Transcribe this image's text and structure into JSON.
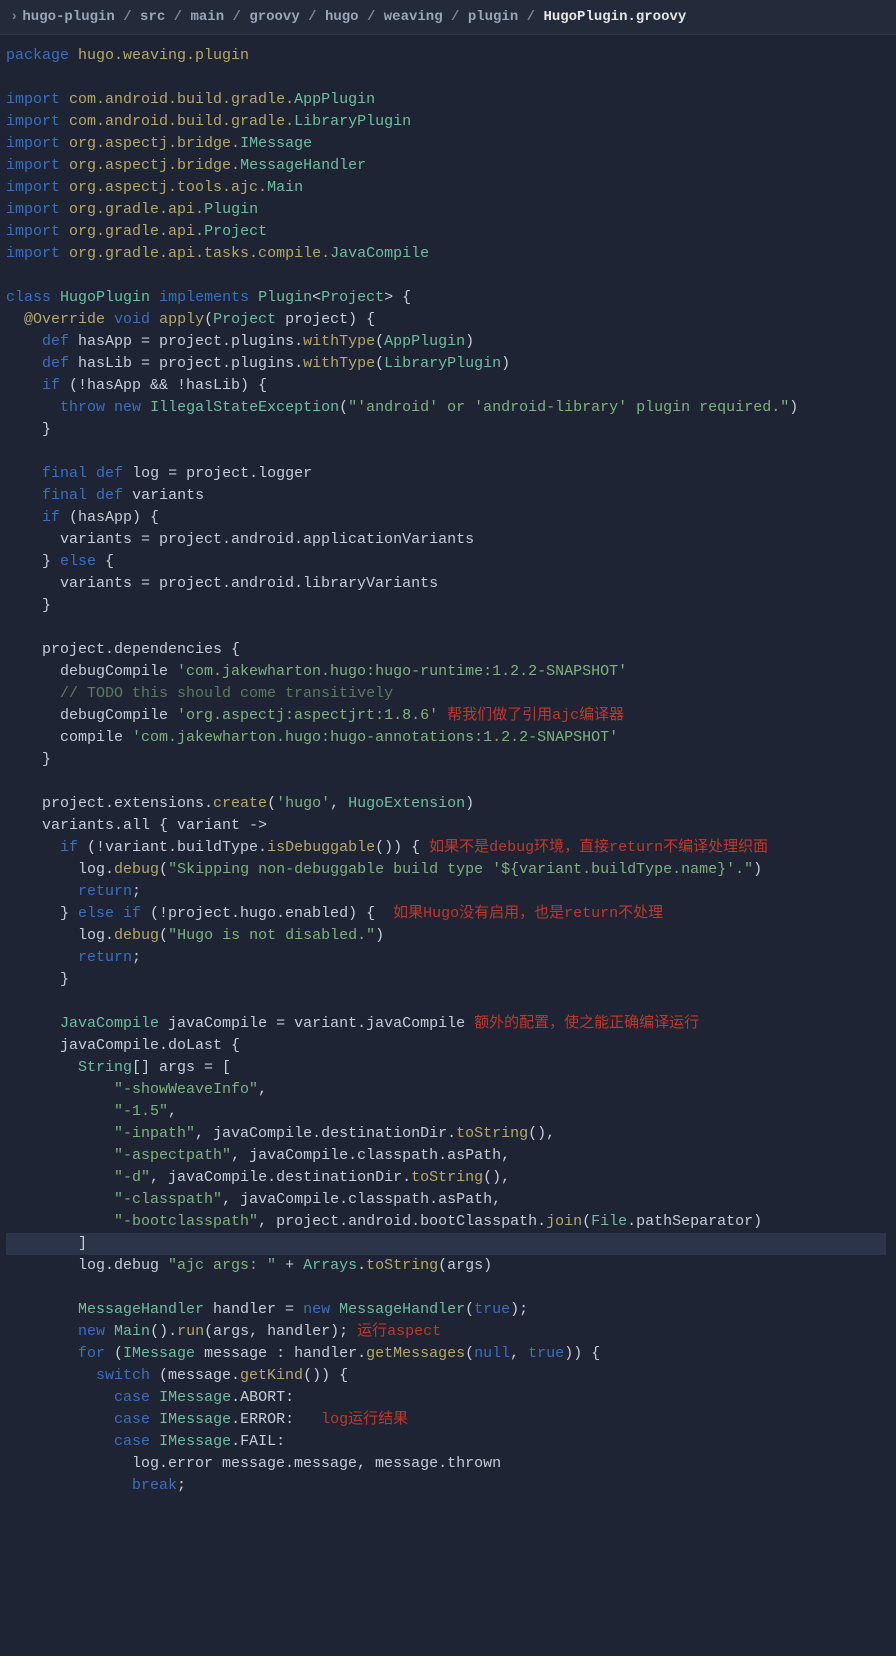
{
  "breadcrumb": {
    "segs": [
      "hugo-plugin",
      "src",
      "main",
      "groovy",
      "hugo",
      "weaving",
      "plugin",
      "HugoPlugin.groovy"
    ],
    "active_index": 7
  },
  "lines": [
    {
      "h": "<span class='kw'>package</span> <span class='pkg'>hugo.weaving.plugin</span>"
    },
    {
      "h": ""
    },
    {
      "h": "<span class='kw'>import</span> <span class='pkg'>com.android.build.gradle.</span><span class='typ'>AppPlugin</span>"
    },
    {
      "h": "<span class='kw'>import</span> <span class='pkg'>com.android.build.gradle.</span><span class='typ'>LibraryPlugin</span>"
    },
    {
      "h": "<span class='kw'>import</span> <span class='pkg'>org.aspectj.bridge.</span><span class='typ'>IMessage</span>"
    },
    {
      "h": "<span class='kw'>import</span> <span class='pkg'>org.aspectj.bridge.</span><span class='typ'>MessageHandler</span>"
    },
    {
      "h": "<span class='kw'>import</span> <span class='pkg'>org.aspectj.tools.ajc.</span><span class='typ'>Main</span>"
    },
    {
      "h": "<span class='kw'>import</span> <span class='pkg'>org.gradle.api.</span><span class='typ'>Plugin</span>"
    },
    {
      "h": "<span class='kw'>import</span> <span class='pkg'>org.gradle.api.</span><span class='typ'>Project</span>"
    },
    {
      "h": "<span class='kw'>import</span> <span class='pkg'>org.gradle.api.tasks.compile.</span><span class='typ'>JavaCompile</span>"
    },
    {
      "h": ""
    },
    {
      "h": "<span class='kw'>class</span> <span class='typ'>HugoPlugin</span> <span class='kw'>implements</span> <span class='typ'>Plugin</span>&lt;<span class='typ'>Project</span>&gt; {"
    },
    {
      "h": "  <span class='ann'>@Override</span> <span class='kw'>void</span> <span class='fn'>apply</span>(<span class='typ'>Project</span> project) {"
    },
    {
      "h": "    <span class='kw'>def</span> hasApp = project.plugins.<span class='fn'>withType</span>(<span class='typ'>AppPlugin</span>)"
    },
    {
      "h": "    <span class='kw'>def</span> hasLib = project.plugins.<span class='fn'>withType</span>(<span class='typ'>LibraryPlugin</span>)"
    },
    {
      "h": "    <span class='kw'>if</span> (!hasApp &amp;&amp; !hasLib) {"
    },
    {
      "h": "      <span class='kw'>throw</span> <span class='kw'>new</span> <span class='typ'>IllegalStateException</span>(<span class='str'>\"'android' or 'android-library' plugin required.\"</span>)"
    },
    {
      "h": "    }"
    },
    {
      "h": ""
    },
    {
      "h": "    <span class='kw'>final</span> <span class='kw'>def</span> log = project.logger"
    },
    {
      "h": "    <span class='kw'>final</span> <span class='kw'>def</span> variants"
    },
    {
      "h": "    <span class='kw'>if</span> (hasApp) {"
    },
    {
      "h": "      variants = project.android.applicationVariants"
    },
    {
      "h": "    } <span class='kw'>else</span> {"
    },
    {
      "h": "      variants = project.android.libraryVariants"
    },
    {
      "h": "    }"
    },
    {
      "h": ""
    },
    {
      "h": "    project.dependencies {"
    },
    {
      "h": "      debugCompile <span class='str'>'com.jakewharton.hugo:hugo-runtime:1.2.2-SNAPSHOT'</span>"
    },
    {
      "h": "      <span class='cmt'>// TODO this should come transitively</span>"
    },
    {
      "h": "      debugCompile <span class='str'>'org.aspectj:aspectjrt:1.8.6'</span> <span class='red'>帮我们做了引用ajc编译器</span>"
    },
    {
      "h": "      compile <span class='str'>'com.jakewharton.hugo:hugo-annotations:1.2.2-SNAPSHOT'</span>"
    },
    {
      "h": "    }"
    },
    {
      "h": ""
    },
    {
      "h": "    project.extensions.<span class='fn'>create</span>(<span class='str'>'hugo'</span>, <span class='typ'>HugoExtension</span>)"
    },
    {
      "h": "    variants.all { variant -&gt;"
    },
    {
      "h": "      <span class='kw'>if</span> (!variant.buildType.<span class='fn'>isDebuggable</span>()) { <span class='red'>如果不是debug环境，直接return不编译处理织面</span>"
    },
    {
      "h": "        log.<span class='fn'>debug</span>(<span class='str'>\"Skipping non-debuggable build type '${variant.buildType.name}'.\"</span>)"
    },
    {
      "h": "        <span class='kw'>return</span>;"
    },
    {
      "h": "      } <span class='kw'>else if</span> (!project.hugo.enabled) {  <span class='red'>如果Hugo没有启用，也是return不处理</span>"
    },
    {
      "h": "        log.<span class='fn'>debug</span>(<span class='str'>\"Hugo is not disabled.\"</span>)"
    },
    {
      "h": "        <span class='kw'>return</span>;"
    },
    {
      "h": "      }"
    },
    {
      "h": ""
    },
    {
      "h": "      <span class='typ'>JavaCompile</span> javaCompile = variant.javaCompile <span class='red'>额外的配置，使之能正确编译运行</span>"
    },
    {
      "h": "      javaCompile.doLast {"
    },
    {
      "h": "        <span class='typ'>String</span>[] args = ["
    },
    {
      "h": "            <span class='str'>\"-showWeaveInfo\"</span>,"
    },
    {
      "h": "            <span class='str'>\"-1.5\"</span>,"
    },
    {
      "h": "            <span class='str'>\"-inpath\"</span>, javaCompile.destinationDir.<span class='fn'>toString</span>(),"
    },
    {
      "h": "            <span class='str'>\"-aspectpath\"</span>, javaCompile.classpath.asPath,"
    },
    {
      "h": "            <span class='str'>\"-d\"</span>, javaCompile.destinationDir.<span class='fn'>toString</span>(),"
    },
    {
      "h": "            <span class='str'>\"-classpath\"</span>, javaCompile.classpath.asPath,"
    },
    {
      "h": "            <span class='str'>\"-bootclasspath\"</span>, project.android.bootClasspath.<span class='fn'>join</span>(<span class='typ'>File</span>.pathSeparator)"
    },
    {
      "h": "        ]",
      "hl": true
    },
    {
      "h": "        log.debug <span class='str'>\"ajc args: \"</span> + <span class='typ'>Arrays</span>.<span class='fn'>toString</span>(args)"
    },
    {
      "h": ""
    },
    {
      "h": "        <span class='typ'>MessageHandler</span> handler = <span class='kw'>new</span> <span class='typ'>MessageHandler</span>(<span class='kw'>true</span>);"
    },
    {
      "h": "        <span class='kw'>new</span> <span class='typ'>Main</span>().<span class='fn'>run</span>(args, handler); <span class='red'>运行aspect</span>"
    },
    {
      "h": "        <span class='kw'>for</span> (<span class='typ'>IMessage</span> message : handler.<span class='fn'>getMessages</span>(<span class='kw'>null</span>, <span class='kw'>true</span>)) {"
    },
    {
      "h": "          <span class='kw'>switch</span> (message.<span class='fn'>getKind</span>()) {"
    },
    {
      "h": "            <span class='kw'>case</span> <span class='typ'>IMessage</span>.ABORT:"
    },
    {
      "h": "            <span class='kw'>case</span> <span class='typ'>IMessage</span>.ERROR:   <span class='red'>log运行结果</span>"
    },
    {
      "h": "            <span class='kw'>case</span> <span class='typ'>IMessage</span>.FAIL:"
    },
    {
      "h": "              log.error message.message, message.thrown"
    },
    {
      "h": "              <span class='kw'>break</span>;"
    }
  ]
}
